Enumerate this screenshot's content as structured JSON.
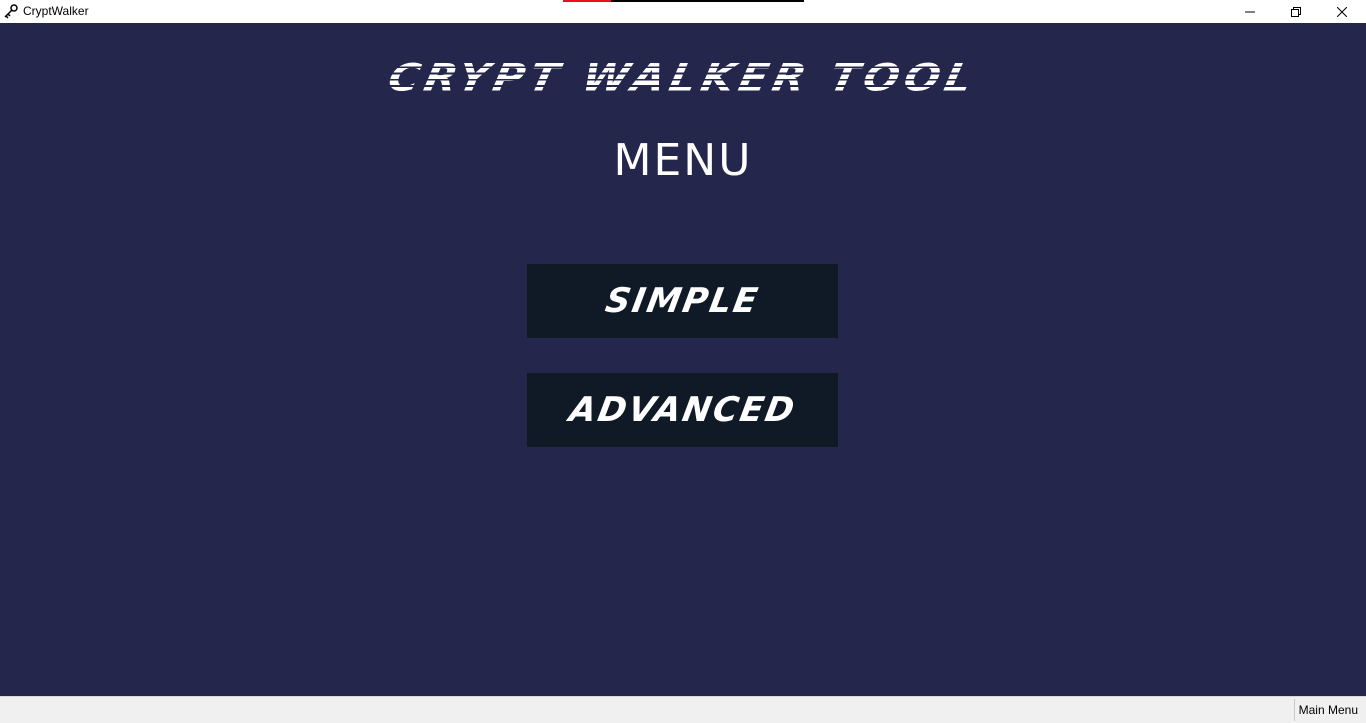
{
  "window": {
    "title": "CryptWalker",
    "app_icon": "key-icon",
    "controls": {
      "minimize_icon": "minimize-icon",
      "maximize_icon": "restore-icon",
      "close_icon": "close-icon"
    }
  },
  "main": {
    "app_title": "CRYPT WALKER TOOL",
    "menu_heading": "MENU",
    "buttons": {
      "simple_label": "SIMPLE",
      "advanced_label": "ADVANCED"
    }
  },
  "statusbar": {
    "text": "Main Menu"
  },
  "colors": {
    "background": "#25264b",
    "button_bg": "#101a27",
    "text": "#ffffff",
    "titlebar_accent": "#e81123"
  }
}
